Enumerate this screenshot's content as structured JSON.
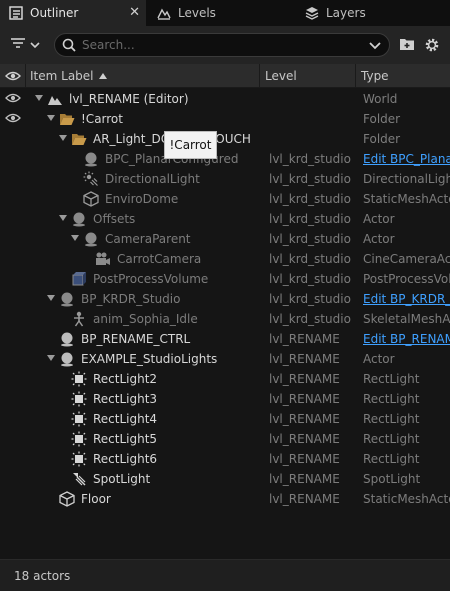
{
  "tabs": [
    {
      "label": "Outliner",
      "icon": "outliner-icon",
      "active": true
    },
    {
      "label": "Levels",
      "icon": "levels-icon",
      "active": false
    },
    {
      "label": "Layers",
      "icon": "layers-icon",
      "active": false
    }
  ],
  "toolbar": {
    "search_placeholder": "Search..."
  },
  "columns": {
    "label": "Item Label",
    "level": "Level",
    "type": "Type"
  },
  "tooltip": "!Carrot",
  "rows": [
    {
      "label": "lvl_RENAME (Editor)",
      "level": "",
      "type": "World",
      "icon": "world-icon"
    },
    {
      "label": "!Carrot",
      "level": "",
      "type": "Folder",
      "icon": "folder-open-icon"
    },
    {
      "label": "AR_Light_DO_NOT_TOUCH",
      "level": "",
      "type": "Folder",
      "icon": "folder-open-icon"
    },
    {
      "label": "BPC_PlanarConfigured",
      "level": "lvl_krd_studio",
      "type": "Edit BPC_Planar",
      "icon": "actor-icon"
    },
    {
      "label": "DirectionalLight",
      "level": "lvl_krd_studio",
      "type": "DirectionalLight",
      "icon": "directional-light-icon"
    },
    {
      "label": "EnviroDome",
      "level": "lvl_krd_studio",
      "type": "StaticMeshActor",
      "icon": "static-mesh-icon"
    },
    {
      "label": "Offsets",
      "level": "lvl_krd_studio",
      "type": "Actor",
      "icon": "actor-icon"
    },
    {
      "label": "CameraParent",
      "level": "lvl_krd_studio",
      "type": "Actor",
      "icon": "actor-icon"
    },
    {
      "label": "CarrotCamera",
      "level": "lvl_krd_studio",
      "type": "CineCameraActor",
      "icon": "camera-icon"
    },
    {
      "label": "PostProcessVolume",
      "level": "lvl_krd_studio",
      "type": "PostProcessVolume",
      "icon": "volume-icon"
    },
    {
      "label": "BP_KRDR_Studio",
      "level": "lvl_krd_studio",
      "type": "Edit BP_KRDR_Studio",
      "icon": "actor-icon"
    },
    {
      "label": "anim_Sophia_Idle",
      "level": "lvl_krd_studio",
      "type": "SkeletalMeshActor",
      "icon": "skeletal-mesh-icon"
    },
    {
      "label": "BP_RENAME_CTRL",
      "level": "lvl_RENAME",
      "type": "Edit BP_RENAME_CTRL",
      "icon": "actor-icon"
    },
    {
      "label": "EXAMPLE_StudioLights",
      "level": "lvl_RENAME",
      "type": "Actor",
      "icon": "actor-icon"
    },
    {
      "label": "RectLight2",
      "level": "lvl_RENAME",
      "type": "RectLight",
      "icon": "rect-light-icon"
    },
    {
      "label": "RectLight3",
      "level": "lvl_RENAME",
      "type": "RectLight",
      "icon": "rect-light-icon"
    },
    {
      "label": "RectLight4",
      "level": "lvl_RENAME",
      "type": "RectLight",
      "icon": "rect-light-icon"
    },
    {
      "label": "RectLight5",
      "level": "lvl_RENAME",
      "type": "RectLight",
      "icon": "rect-light-icon"
    },
    {
      "label": "RectLight6",
      "level": "lvl_RENAME",
      "type": "RectLight",
      "icon": "rect-light-icon"
    },
    {
      "label": "SpotLight",
      "level": "lvl_RENAME",
      "type": "SpotLight",
      "icon": "spot-light-icon"
    },
    {
      "label": "Floor",
      "level": "lvl_RENAME",
      "type": "StaticMeshActor",
      "icon": "static-mesh-icon"
    }
  ],
  "status": "18 actors",
  "colors": {
    "link": "#3fa0ff",
    "folder": "#c89a4a",
    "background": "#151515"
  }
}
